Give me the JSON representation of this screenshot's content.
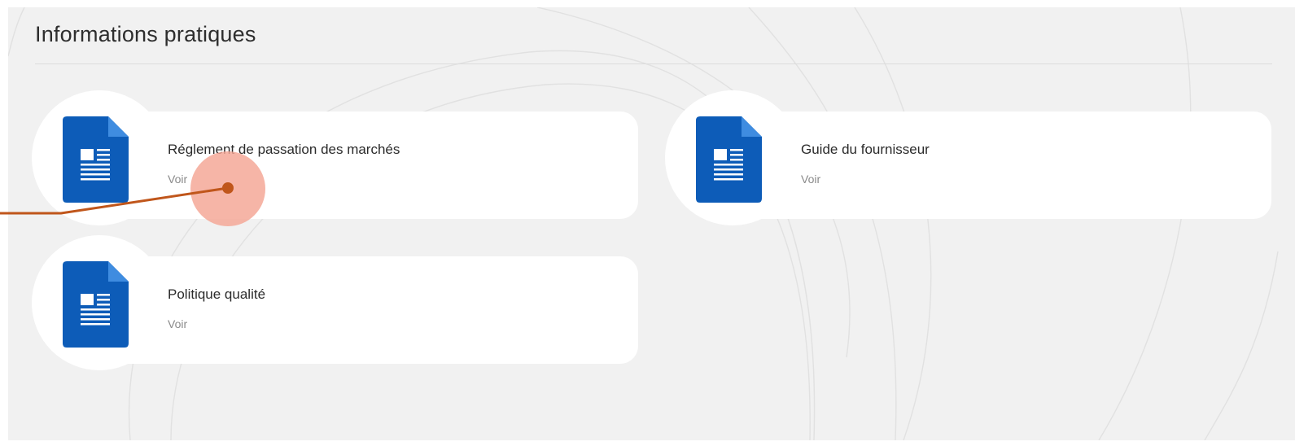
{
  "section": {
    "title": "Informations pratiques"
  },
  "documents": [
    {
      "title": "Réglement de passation des marchés",
      "link_label": "Voir",
      "icon": "document-icon"
    },
    {
      "title": "Guide du fournisseur",
      "link_label": "Voir",
      "icon": "document-icon"
    },
    {
      "title": "Politique qualité",
      "link_label": "Voir",
      "icon": "document-icon"
    }
  ],
  "colors": {
    "icon_blue": "#0d5cb8",
    "icon_fold": "#3f8ce0",
    "panel_background": "#f1f1f1",
    "card_background": "#ffffff",
    "click_marker": "#f4a594",
    "click_line": "#c0561b"
  }
}
